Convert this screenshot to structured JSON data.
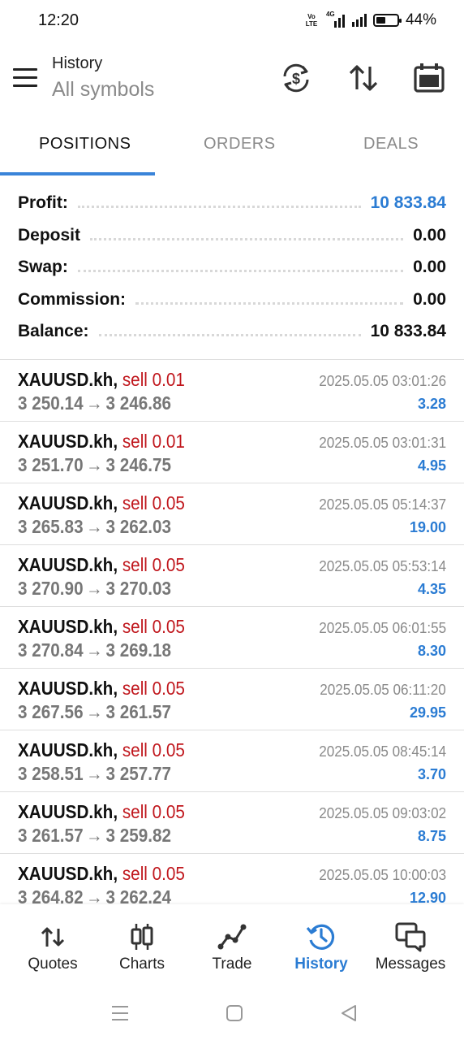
{
  "status_bar": {
    "time": "12:20",
    "volte_label": "Vo LTE",
    "network_label": "4G",
    "battery_percent_label": "44%",
    "battery_level": 0.44
  },
  "app_bar": {
    "title": "History",
    "subtitle": "All symbols",
    "actions": [
      "currency-sync-icon",
      "sort-icon",
      "calendar-icon"
    ]
  },
  "tabs": [
    {
      "label": "POSITIONS",
      "active": true
    },
    {
      "label": "ORDERS",
      "active": false
    },
    {
      "label": "DEALS",
      "active": false
    }
  ],
  "summary": [
    {
      "label": "Profit:",
      "value": "10 833.84",
      "highlight": true
    },
    {
      "label": "Deposit",
      "value": "0.00",
      "highlight": false
    },
    {
      "label": "Swap:",
      "value": "0.00",
      "highlight": false
    },
    {
      "label": "Commission:",
      "value": "0.00",
      "highlight": false
    },
    {
      "label": "Balance:",
      "value": "10 833.84",
      "highlight": false
    }
  ],
  "deals": [
    {
      "symbol": "XAUUSD.kh,",
      "side": "sell 0.01",
      "open": "3 250.14",
      "arrow": "→",
      "close": "3 246.86",
      "time": "2025.05.05 03:01:26",
      "profit": "3.28"
    },
    {
      "symbol": "XAUUSD.kh,",
      "side": "sell 0.01",
      "open": "3 251.70",
      "arrow": "→",
      "close": "3 246.75",
      "time": "2025.05.05 03:01:31",
      "profit": "4.95"
    },
    {
      "symbol": "XAUUSD.kh,",
      "side": "sell 0.05",
      "open": "3 265.83",
      "arrow": "→",
      "close": "3 262.03",
      "time": "2025.05.05 05:14:37",
      "profit": "19.00"
    },
    {
      "symbol": "XAUUSD.kh,",
      "side": "sell 0.05",
      "open": "3 270.90",
      "arrow": "→",
      "close": "3 270.03",
      "time": "2025.05.05 05:53:14",
      "profit": "4.35"
    },
    {
      "symbol": "XAUUSD.kh,",
      "side": "sell 0.05",
      "open": "3 270.84",
      "arrow": "→",
      "close": "3 269.18",
      "time": "2025.05.05 06:01:55",
      "profit": "8.30"
    },
    {
      "symbol": "XAUUSD.kh,",
      "side": "sell 0.05",
      "open": "3 267.56",
      "arrow": "→",
      "close": "3 261.57",
      "time": "2025.05.05 06:11:20",
      "profit": "29.95"
    },
    {
      "symbol": "XAUUSD.kh,",
      "side": "sell 0.05",
      "open": "3 258.51",
      "arrow": "→",
      "close": "3 257.77",
      "time": "2025.05.05 08:45:14",
      "profit": "3.70"
    },
    {
      "symbol": "XAUUSD.kh,",
      "side": "sell 0.05",
      "open": "3 261.57",
      "arrow": "→",
      "close": "3 259.82",
      "time": "2025.05.05 09:03:02",
      "profit": "8.75"
    },
    {
      "symbol": "XAUUSD.kh,",
      "side": "sell 0.05",
      "open": "3 264.82",
      "arrow": "→",
      "close": "3 262.24",
      "time": "2025.05.05 10:00:03",
      "profit": "12.90"
    }
  ],
  "bottom_nav": [
    {
      "label": "Quotes",
      "icon": "quotes-icon",
      "active": false
    },
    {
      "label": "Charts",
      "icon": "charts-icon",
      "active": false
    },
    {
      "label": "Trade",
      "icon": "trade-icon",
      "active": false
    },
    {
      "label": "History",
      "icon": "history-icon",
      "active": true
    },
    {
      "label": "Messages",
      "icon": "messages-icon",
      "active": false
    }
  ],
  "system_nav": [
    "recents-icon",
    "home-icon",
    "back-icon"
  ],
  "colors": {
    "accent": "#2b7cd3",
    "sell": "#c0161c",
    "muted": "#8a8a8a"
  }
}
